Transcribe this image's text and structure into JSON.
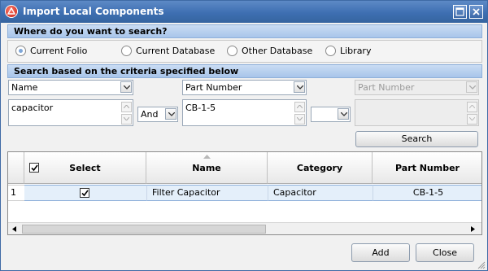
{
  "window": {
    "title": "Import Local Components"
  },
  "icons": {
    "app": "app-logo-icon",
    "max": "maximize-icon",
    "close": "close-icon"
  },
  "where": {
    "header": "Where do you want to search?",
    "options": [
      "Current Folio",
      "Current Database",
      "Other Database",
      "Library"
    ],
    "selected": "Current Folio"
  },
  "criteria": {
    "header": "Search based on the criteria specified below",
    "field1": "Name",
    "value1": "capacitor",
    "operator": "And",
    "field2": "Part Number",
    "value2": "CB-1-5",
    "operator2": "",
    "field3": "Part Number",
    "value3": "",
    "search_label": "Search"
  },
  "grid": {
    "columns": [
      "Select",
      "Name",
      "Category",
      "Part Number"
    ],
    "rows": [
      {
        "index": "1",
        "select": true,
        "name": "Filter Capacitor",
        "category": "Capacitor",
        "part_number": "CB-1-5"
      }
    ]
  },
  "footer": {
    "add_label": "Add",
    "close_label": "Close"
  }
}
